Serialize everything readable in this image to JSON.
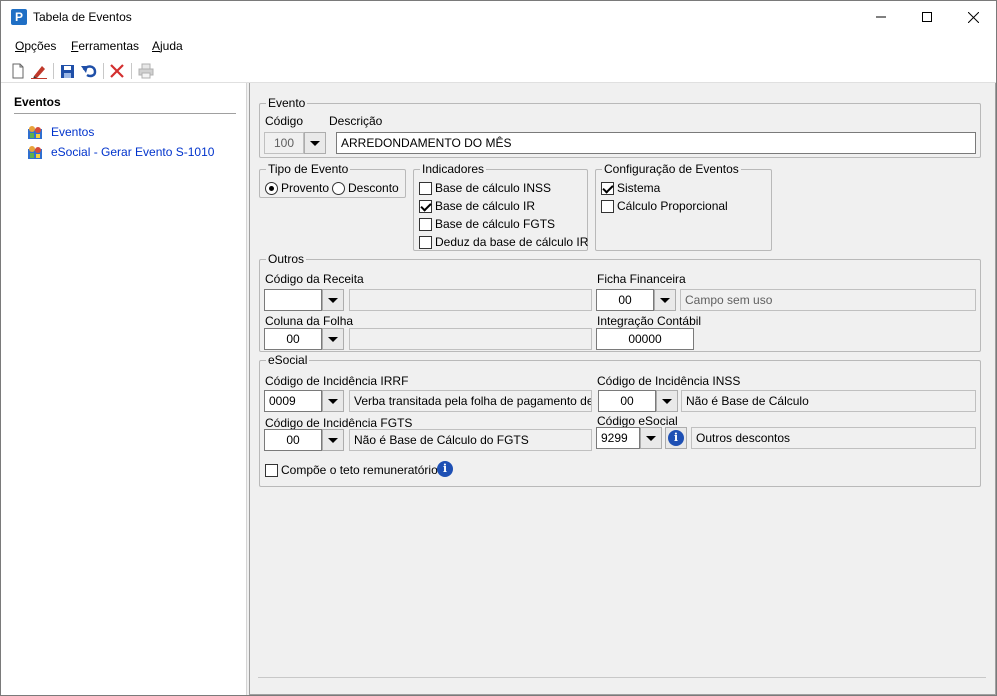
{
  "window": {
    "title": "Tabela de Eventos",
    "icon": "P"
  },
  "menu": [
    {
      "label": "Opções",
      "accel": "O"
    },
    {
      "label": "Ferramentas",
      "accel": "F"
    },
    {
      "label": "Ajuda",
      "accel": "A"
    }
  ],
  "toolbar": [
    "new-document-icon",
    "edit-pencil-icon",
    "save-disk-icon",
    "undo-icon",
    "delete-x-icon",
    "print-icon"
  ],
  "sidebar": {
    "title": "Eventos",
    "items": [
      {
        "label": "Eventos"
      },
      {
        "label": "eSocial - Gerar Evento S-1010"
      }
    ]
  },
  "evento": {
    "group_title": "Evento",
    "codigo_label": "Código",
    "codigo_value": "100",
    "descricao_label": "Descrição",
    "descricao_value": "ARREDONDAMENTO DO MÊS"
  },
  "tipo_evento": {
    "group_title": "Tipo de Evento",
    "options": [
      {
        "label": "Provento",
        "checked": true
      },
      {
        "label": "Desconto",
        "checked": false
      }
    ]
  },
  "indicadores": {
    "group_title": "Indicadores",
    "items": [
      {
        "label": "Base de cálculo INSS",
        "checked": false
      },
      {
        "label": "Base de cálculo IR",
        "checked": true
      },
      {
        "label": "Base de cálculo FGTS",
        "checked": false
      },
      {
        "label": "Deduz da base de cálculo IR",
        "checked": false
      }
    ]
  },
  "config_eventos": {
    "group_title": "Configuração de Eventos",
    "items": [
      {
        "label": "Sistema",
        "checked": true
      },
      {
        "label": "Cálculo Proporcional",
        "checked": false
      }
    ]
  },
  "outros": {
    "group_title": "Outros",
    "codigo_receita_label": "Código da Receita",
    "codigo_receita_value": "",
    "codigo_receita_desc": "",
    "ficha_financeira_label": "Ficha Financeira",
    "ficha_financeira_value": "00",
    "ficha_financeira_desc": "Campo sem uso",
    "coluna_folha_label": "Coluna da Folha",
    "coluna_folha_value": "00",
    "coluna_folha_desc": "",
    "integracao_contabil_label": "Integração Contábil",
    "integracao_contabil_value": "00000"
  },
  "esocial": {
    "group_title": "eSocial",
    "irrf_label": "Código de Incidência IRRF",
    "irrf_value": "0009",
    "irrf_desc": "Verba transitada pela folha de pagamento de natu",
    "inss_label": "Código de Incidência INSS",
    "inss_value": "00",
    "inss_desc": "Não é Base de Cálculo",
    "fgts_label": "Código de Incidência FGTS",
    "fgts_value": "00",
    "fgts_desc": "Não é Base de Cálculo do FGTS",
    "codigo_esocial_label": "Código eSocial",
    "codigo_esocial_value": "9299",
    "codigo_esocial_desc": "Outros descontos",
    "teto_label": "Compõe o teto remuneratório?",
    "teto_checked": false
  }
}
